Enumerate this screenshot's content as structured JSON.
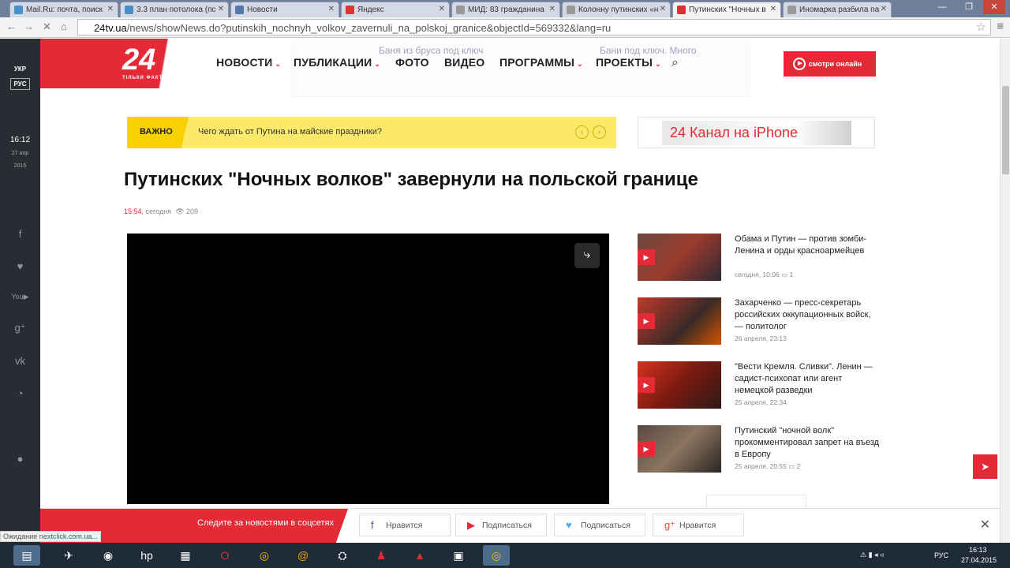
{
  "browser": {
    "tabs": [
      {
        "title": "Mail.Ru: почта, поиск"
      },
      {
        "title": "3.3 план потолока (пс"
      },
      {
        "title": "Новости"
      },
      {
        "title": "Яндекс"
      },
      {
        "title": "МИД: 83 гражданина"
      },
      {
        "title": "Колонну путинских «н"
      },
      {
        "title": "Путинских \"Ночных в"
      },
      {
        "title": "Иномарка разбила па"
      }
    ],
    "url_host": "24tv.ua",
    "url_path": "/news/showNews.do?putinskih_nochnyh_volkov_zavernuli_na_polskoj_granice&objectId=569332&lang=ru",
    "status": "Ожидание nextclick.com.ua..."
  },
  "sidebar": {
    "lang_ukr": "УКР",
    "lang_rus": "РУС",
    "time": "16:12",
    "date_day": "27 апр",
    "date_year": "2015"
  },
  "logo": {
    "number": "24",
    "slogan": "ТІЛЬКИ ФАКТИ"
  },
  "nav": {
    "news": "НОВОСТИ",
    "pubs": "ПУБЛИКАЦИИ",
    "photo": "ФОТО",
    "video": "ВИДЕО",
    "programs": "ПРОГРАММЫ",
    "projects": "ПРОЕКТЫ",
    "watch": "смотри онлайн"
  },
  "ad": {
    "a": "Баня из бруса под ключ",
    "b": "Бани под ключ. Много"
  },
  "important": {
    "label": "ВАЖНО",
    "text": "Чего ждать от Путина на майские праздники?"
  },
  "banner": {
    "brand": "24 Канал",
    "suffix": " на iPhone"
  },
  "article": {
    "title": "Путинских \"Ночных волков\" завернули на польской границе",
    "time": "15:54,",
    "when": "сегодня",
    "views": "209"
  },
  "related": [
    {
      "title": "Обама и Путин — против зомби-Ленина и орды красноармейцев",
      "meta": "сегодня, 10:06",
      "comments": "1"
    },
    {
      "title": "Захарченко — пресс-секретарь российских оккупационных войск, — политолог",
      "meta": "26 апреля, 23:13",
      "comments": ""
    },
    {
      "title": "\"Вести Кремля. Сливки\". Ленин — садист-психопат или агент немецкой разведки",
      "meta": "25 апреля, 22:34",
      "comments": ""
    },
    {
      "title": "Путинский \"ночной волк\" прокомментировал запрет на въезд в Европу",
      "meta": "25 апреля, 20:55",
      "comments": "2"
    }
  ],
  "follow": {
    "label": "Следите за новостями в соцсетях",
    "fb": "Нравится",
    "yt": "Подписаться",
    "tw": "Подписаться",
    "gp": "Нравится"
  },
  "taskbar": {
    "lang": "РУС",
    "time": "16:13",
    "date": "27.04.2015"
  },
  "colors": {
    "brand": "#e32a36",
    "important": "#fce96a",
    "sidebar": "#272d33"
  }
}
